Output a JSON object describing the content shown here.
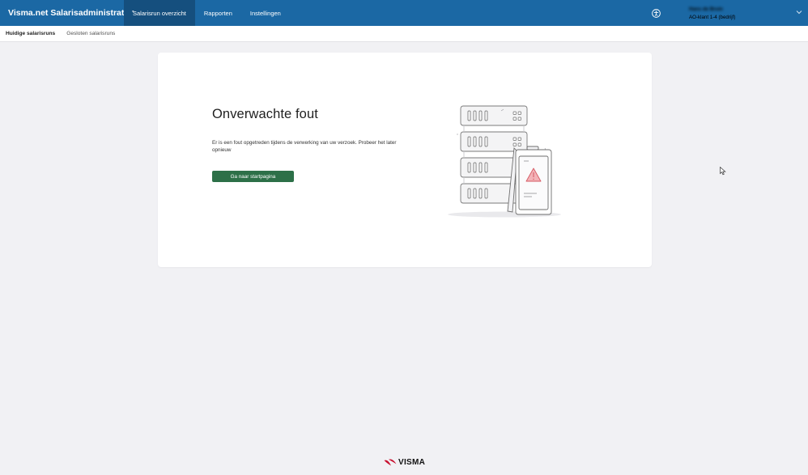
{
  "header": {
    "brand": "Visma.net Salarisadministratie",
    "brand_sup": "*",
    "nav": [
      {
        "label": "Salarisrun overzicht",
        "active": true
      },
      {
        "label": "Rapporten",
        "active": false
      },
      {
        "label": "Instellingen",
        "active": false
      }
    ],
    "user": {
      "name": "Hans de Bruin",
      "company": "AO-klant 1-4 (bedrijf)"
    },
    "colors": {
      "bar": "#1b68a4",
      "active": "#154f7e"
    }
  },
  "subnav": [
    {
      "label": "Huidige salarisruns",
      "active": true
    },
    {
      "label": "Gesloten salarisruns",
      "active": false
    }
  ],
  "error": {
    "title": "Onverwachte fout",
    "message": "Er is een fout opgetreden tijdens de verwerking van uw verzoek. Probeer het later opnieuw",
    "button": "Ga naar startpagina",
    "button_color": "#2d7048",
    "illustration": "server-rack-with-warning-sign"
  },
  "footer": {
    "logo_text": "VISMA",
    "logo_color": "#c8102e"
  }
}
